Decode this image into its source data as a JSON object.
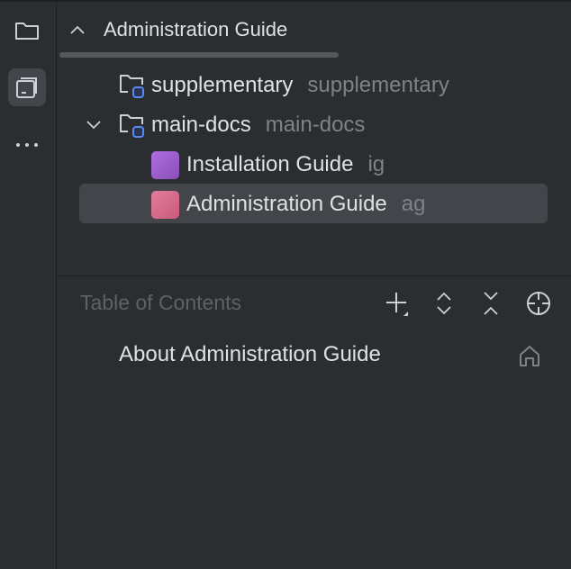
{
  "header": {
    "title": "Administration Guide"
  },
  "tree": [
    {
      "label": "supplementary",
      "sub": "supplementary"
    },
    {
      "label": "main-docs",
      "sub": "main-docs"
    },
    {
      "label": "Installation Guide",
      "sub": "ig",
      "color": "#9d5bd0"
    },
    {
      "label": "Administration Guide",
      "sub": "ag",
      "color": "#d9698a"
    }
  ],
  "toc": {
    "title": "Table of Contents",
    "items": [
      "About Administration Guide"
    ]
  }
}
